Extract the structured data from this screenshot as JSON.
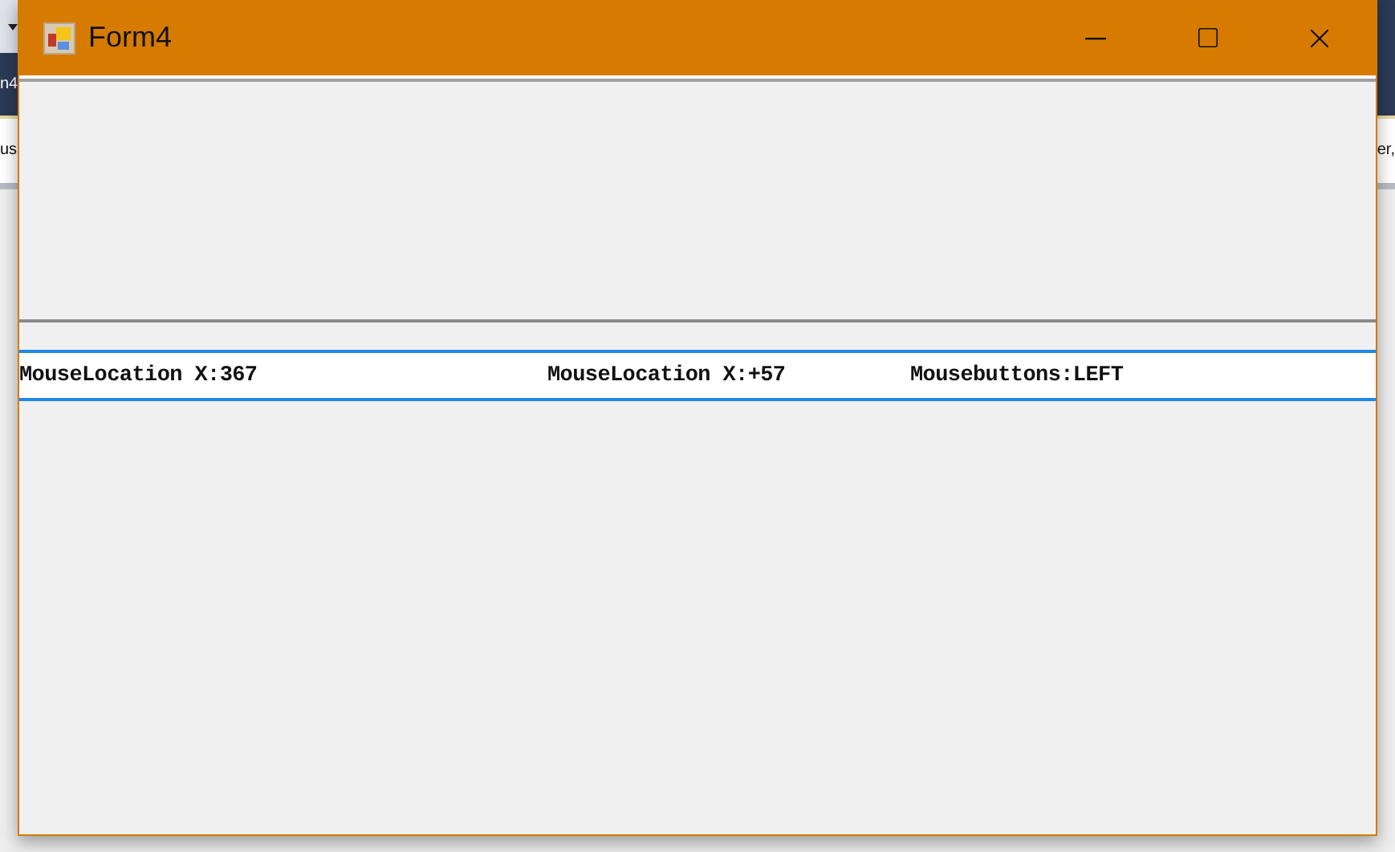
{
  "background": {
    "left_texts": [
      "n4",
      "us"
    ],
    "right_texts": [
      "er,"
    ]
  },
  "window": {
    "title": "Form4"
  },
  "textbox": {
    "segments": [
      "MouseLocation X:367",
      "MouseLocation X:+57",
      "Mousebuttons:LEFT"
    ]
  }
}
